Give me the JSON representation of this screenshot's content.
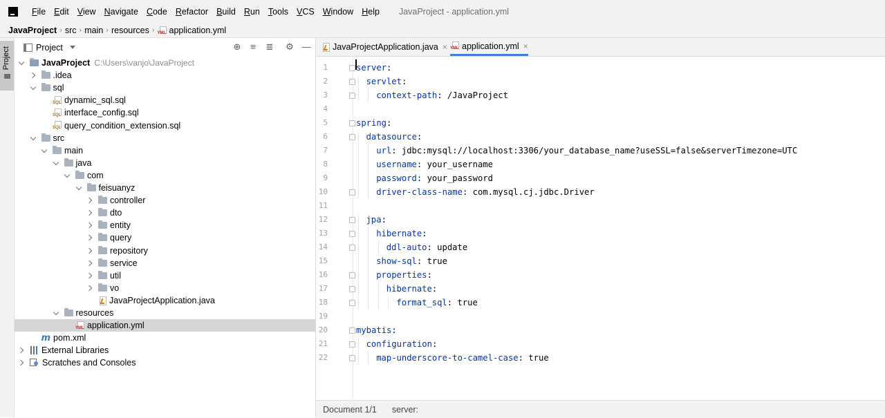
{
  "menubar": {
    "items": [
      {
        "underline": "F",
        "rest": "ile"
      },
      {
        "underline": "E",
        "rest": "dit"
      },
      {
        "underline": "V",
        "rest": "iew"
      },
      {
        "underline": "N",
        "rest": "avigate"
      },
      {
        "underline": "C",
        "rest": "ode"
      },
      {
        "underline": "R",
        "rest": "efactor"
      },
      {
        "underline": "B",
        "rest": "uild"
      },
      {
        "underline": "R",
        "rest": "un"
      },
      {
        "underline": "T",
        "rest": "ools"
      },
      {
        "underline": "V",
        "rest": "CS"
      },
      {
        "underline": "W",
        "rest": "indow"
      },
      {
        "underline": "H",
        "rest": "elp"
      }
    ],
    "window_title": "JavaProject - application.yml"
  },
  "breadcrumb": [
    "JavaProject",
    "src",
    "main",
    "resources",
    "application.yml"
  ],
  "tool_strip": {
    "project_label": "Project"
  },
  "project_panel": {
    "title": "Project",
    "tree": [
      {
        "label": "JavaProject",
        "hint": "C:\\Users\\vanjo\\JavaProject",
        "depth": 0,
        "chev": "down",
        "icon": "module-folder-icon",
        "bold": true
      },
      {
        "label": ".idea",
        "depth": 1,
        "chev": "right",
        "icon": "folder-icon"
      },
      {
        "label": "sql",
        "depth": 1,
        "chev": "down",
        "icon": "folder-icon"
      },
      {
        "label": "dynamic_sql.sql",
        "depth": 2,
        "chev": "none",
        "icon": "sql-file-icon"
      },
      {
        "label": "interface_config.sql",
        "depth": 2,
        "chev": "none",
        "icon": "sql-file-icon"
      },
      {
        "label": "query_condition_extension.sql",
        "depth": 2,
        "chev": "none",
        "icon": "sql-file-icon"
      },
      {
        "label": "src",
        "depth": 1,
        "chev": "down",
        "icon": "folder-icon"
      },
      {
        "label": "main",
        "depth": 2,
        "chev": "down",
        "icon": "folder-icon"
      },
      {
        "label": "java",
        "depth": 3,
        "chev": "down",
        "icon": "folder-icon"
      },
      {
        "label": "com",
        "depth": 4,
        "chev": "down",
        "icon": "folder-icon"
      },
      {
        "label": "feisuanyz",
        "depth": 5,
        "chev": "down",
        "icon": "folder-icon"
      },
      {
        "label": "controller",
        "depth": 6,
        "chev": "right",
        "icon": "folder-icon"
      },
      {
        "label": "dto",
        "depth": 6,
        "chev": "right",
        "icon": "folder-icon"
      },
      {
        "label": "entity",
        "depth": 6,
        "chev": "right",
        "icon": "folder-icon"
      },
      {
        "label": "query",
        "depth": 6,
        "chev": "right",
        "icon": "folder-icon"
      },
      {
        "label": "repository",
        "depth": 6,
        "chev": "right",
        "icon": "folder-icon"
      },
      {
        "label": "service",
        "depth": 6,
        "chev": "right",
        "icon": "folder-icon"
      },
      {
        "label": "util",
        "depth": 6,
        "chev": "right",
        "icon": "folder-icon"
      },
      {
        "label": "vo",
        "depth": 6,
        "chev": "right",
        "icon": "folder-icon"
      },
      {
        "label": "JavaProjectApplication.java",
        "depth": 6,
        "chev": "none",
        "icon": "java-file-icon"
      },
      {
        "label": "resources",
        "depth": 3,
        "chev": "down",
        "icon": "folder-icon"
      },
      {
        "label": "application.yml",
        "depth": 4,
        "chev": "none",
        "icon": "yml-file-icon",
        "selected": true
      },
      {
        "label": "pom.xml",
        "depth": 1,
        "chev": "none",
        "icon": "maven-icon"
      },
      {
        "label": "External Libraries",
        "depth": 0,
        "chev": "right",
        "icon": "libraries-icon"
      },
      {
        "label": "Scratches and Consoles",
        "depth": 0,
        "chev": "right",
        "icon": "scratches-icon"
      }
    ]
  },
  "editor": {
    "tabs": [
      {
        "label": "JavaProjectApplication.java",
        "icon": "java-file-icon",
        "active": false
      },
      {
        "label": "application.yml",
        "icon": "yml-file-icon",
        "active": true
      }
    ],
    "lines": [
      {
        "n": "1",
        "indent": 0,
        "key": "server",
        "val": ":",
        "fold": true
      },
      {
        "n": "2",
        "indent": 1,
        "key": "servlet",
        "val": ":",
        "fold": true
      },
      {
        "n": "3",
        "indent": 2,
        "key": "context-path",
        "val": ": /JavaProject",
        "fold": true
      },
      {
        "n": "4",
        "indent": 0,
        "key": "",
        "val": "",
        "fold": false
      },
      {
        "n": "5",
        "indent": 0,
        "key": "spring",
        "val": ":",
        "fold": true
      },
      {
        "n": "6",
        "indent": 1,
        "key": "datasource",
        "val": ":",
        "fold": true
      },
      {
        "n": "7",
        "indent": 2,
        "key": "url",
        "val": ": jdbc:mysql://localhost:3306/your_database_name?useSSL=false&serverTimezone=UTC",
        "fold": false
      },
      {
        "n": "8",
        "indent": 2,
        "key": "username",
        "val": ": your_username",
        "fold": false
      },
      {
        "n": "9",
        "indent": 2,
        "key": "password",
        "val": ": your_password",
        "fold": false
      },
      {
        "n": "10",
        "indent": 2,
        "key": "driver-class-name",
        "val": ": com.mysql.cj.jdbc.Driver",
        "fold": true
      },
      {
        "n": "11",
        "indent": 0,
        "key": "",
        "val": "",
        "fold": false
      },
      {
        "n": "12",
        "indent": 1,
        "key": "jpa",
        "val": ":",
        "fold": true
      },
      {
        "n": "13",
        "indent": 2,
        "key": "hibernate",
        "val": ":",
        "fold": true
      },
      {
        "n": "14",
        "indent": 3,
        "key": "ddl-auto",
        "val": ": update",
        "fold": true
      },
      {
        "n": "15",
        "indent": 2,
        "key": "show-sql",
        "val": ": true",
        "fold": false
      },
      {
        "n": "16",
        "indent": 2,
        "key": "properties",
        "val": ":",
        "fold": true
      },
      {
        "n": "17",
        "indent": 3,
        "key": "hibernate",
        "val": ":",
        "fold": true
      },
      {
        "n": "18",
        "indent": 4,
        "key": "format_sql",
        "val": ": true",
        "fold": true
      },
      {
        "n": "19",
        "indent": 0,
        "key": "",
        "val": "",
        "fold": false
      },
      {
        "n": "20",
        "indent": 0,
        "key": "mybatis",
        "val": ":",
        "fold": true
      },
      {
        "n": "21",
        "indent": 1,
        "key": "configuration",
        "val": ":",
        "fold": true
      },
      {
        "n": "22",
        "indent": 2,
        "key": "map-underscore-to-camel-case",
        "val": ": true",
        "fold": true
      }
    ]
  },
  "statusbar": {
    "document": "Document 1/1",
    "path": "server:"
  },
  "colors": {
    "accent": "#3f7ddb",
    "yaml_key": "#0033b3",
    "selection": "#d5d5d5"
  }
}
